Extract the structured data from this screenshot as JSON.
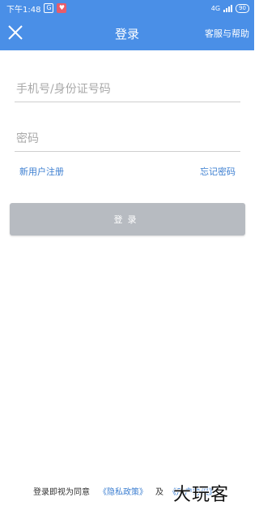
{
  "status_bar": {
    "time": "下午1:48",
    "icon_a": "G",
    "icon_b": "♥",
    "network": "4G",
    "battery": "90"
  },
  "app_bar": {
    "title": "登录",
    "help_label": "客服与帮助",
    "close_icon": "close-icon"
  },
  "form": {
    "phone_placeholder": "手机号/身份证号码",
    "password_placeholder": "密码",
    "phone_value": "",
    "password_value": ""
  },
  "links": {
    "register": "新用户注册",
    "forgot": "忘记密码"
  },
  "login_button": "登录",
  "footer": {
    "prefix": "登录即视为同意",
    "privacy": "《隐私政策》",
    "and": "及",
    "agreement": "《用户协议》"
  },
  "watermark": "大玩客",
  "colors": {
    "header": "#4a8fe7",
    "link": "#3d7fd1",
    "button_disabled": "#b7bbc1"
  }
}
